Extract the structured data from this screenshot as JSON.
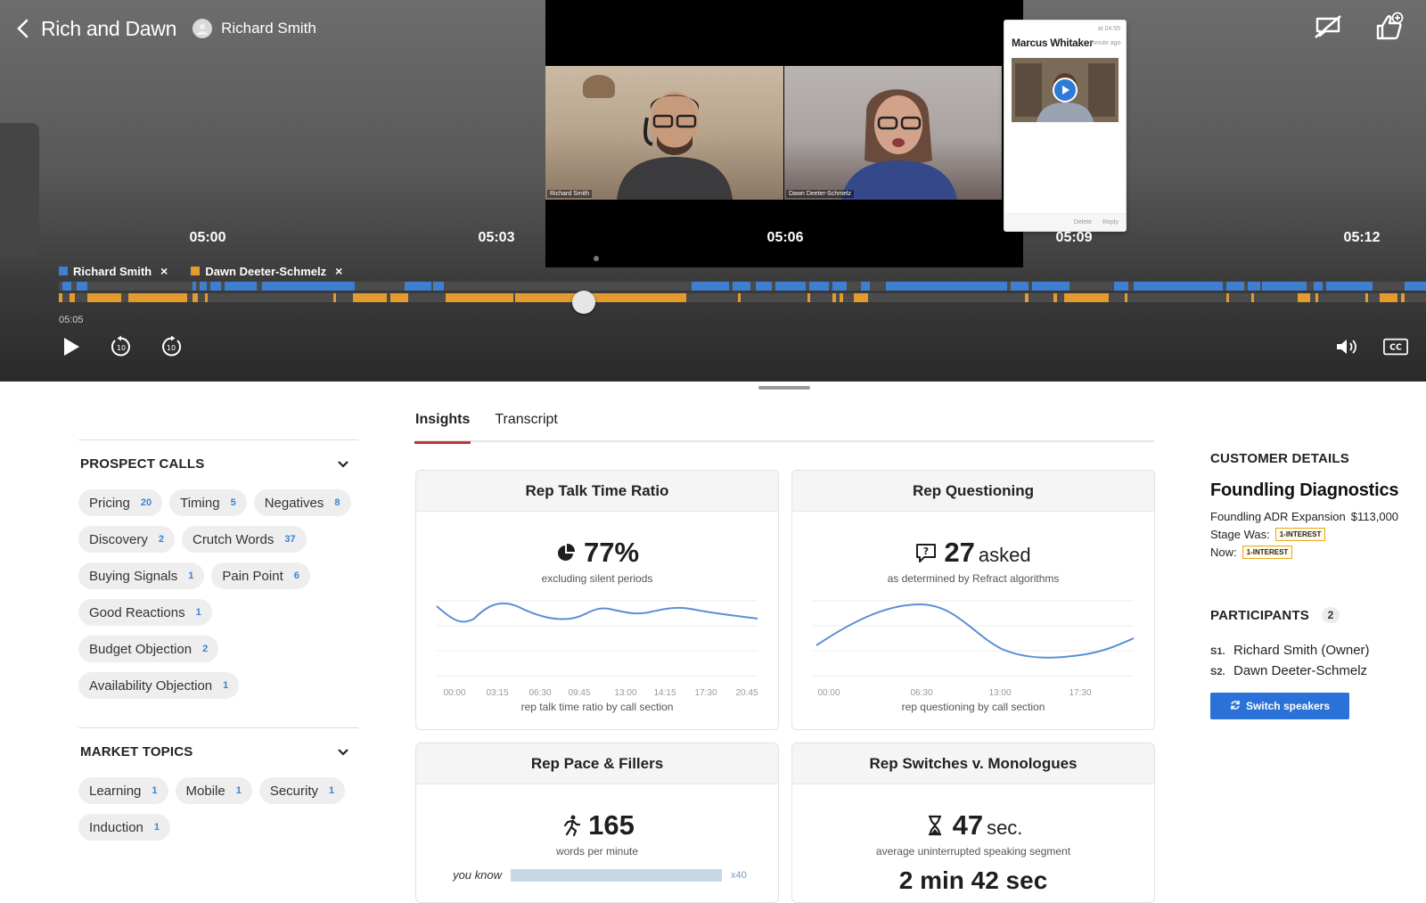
{
  "header": {
    "call_title": "Rich and Dawn",
    "owner_name": "Richard Smith"
  },
  "video": {
    "tile_1_label": "Richard Smith",
    "tile_2_label": "Dawn Deeter-Schmelz"
  },
  "comment": {
    "timestamp": "at 04:55",
    "author": "Marcus Whitaker",
    "ago": "1 minute ago",
    "delete_label": "Delete",
    "reply_label": "Reply"
  },
  "timeline": {
    "marks": [
      "05:00",
      "05:03",
      "05:06",
      "05:09",
      "05:12"
    ],
    "current_time": "05:05",
    "position_fraction": 0.384,
    "speakers": [
      {
        "name": "Richard Smith",
        "color": "#3f7fd0"
      },
      {
        "name": "Dawn Deeter-Schmelz",
        "color": "#e39a2e"
      }
    ]
  },
  "tabs": [
    "Insights",
    "Transcript"
  ],
  "prospect_calls": {
    "title": "PROSPECT CALLS",
    "topics": [
      {
        "label": "Pricing",
        "count": "20"
      },
      {
        "label": "Timing",
        "count": "5"
      },
      {
        "label": "Negatives",
        "count": "8"
      },
      {
        "label": "Discovery",
        "count": "2"
      },
      {
        "label": "Crutch Words",
        "count": "37"
      },
      {
        "label": "Buying Signals",
        "count": "1"
      },
      {
        "label": "Pain Point",
        "count": "6"
      },
      {
        "label": "Good Reactions",
        "count": "1"
      },
      {
        "label": "Budget Objection",
        "count": "2"
      },
      {
        "label": "Availability Objection",
        "count": "1"
      }
    ]
  },
  "market_topics": {
    "title": "MARKET TOPICS",
    "topics": [
      {
        "label": "Learning",
        "count": "1"
      },
      {
        "label": "Mobile",
        "count": "1"
      },
      {
        "label": "Security",
        "count": "1"
      },
      {
        "label": "Induction",
        "count": "1"
      }
    ]
  },
  "cards": {
    "talk_ratio": {
      "title": "Rep Talk Time Ratio",
      "value": "77%",
      "subtitle": "excluding silent periods",
      "x_ticks": [
        "00:00",
        "03:15",
        "06:30",
        "09:45",
        "13:00",
        "14:15",
        "17:30",
        "20:45"
      ],
      "caption": "rep talk time ratio by call section"
    },
    "questioning": {
      "title": "Rep Questioning",
      "value": "27",
      "unit": "asked",
      "subtitle": "as determined by Refract algorithms",
      "x_ticks": [
        "00:00",
        "06:30",
        "13:00",
        "17:30"
      ],
      "caption": "rep questioning by call section"
    },
    "pace": {
      "title": "Rep Pace & Fillers",
      "value": "165",
      "subtitle": "words per minute",
      "filler_label": "you know",
      "filler_count": "x40"
    },
    "switches": {
      "title": "Rep Switches v. Monologues",
      "value": "47",
      "unit": "sec.",
      "subtitle": "average uninterrupted speaking segment",
      "cut_text": "2 min 42 sec"
    }
  },
  "customer": {
    "label": "CUSTOMER DETAILS",
    "company": "Foundling Diagnostics",
    "deal_name": "Foundling ADR Expansion",
    "deal_amount": "$113,000",
    "stage_was_label": "Stage Was:",
    "stage_was": "1-INTEREST",
    "now_label": "Now:",
    "stage_now": "1-INTEREST"
  },
  "participants": {
    "label": "PARTICIPANTS",
    "count": "2",
    "items": [
      {
        "idx": "S1.",
        "name": "Richard Smith (Owner)"
      },
      {
        "idx": "S2.",
        "name": "Dawn Deeter-Schmelz"
      }
    ],
    "switch_label": "Switch speakers"
  }
}
